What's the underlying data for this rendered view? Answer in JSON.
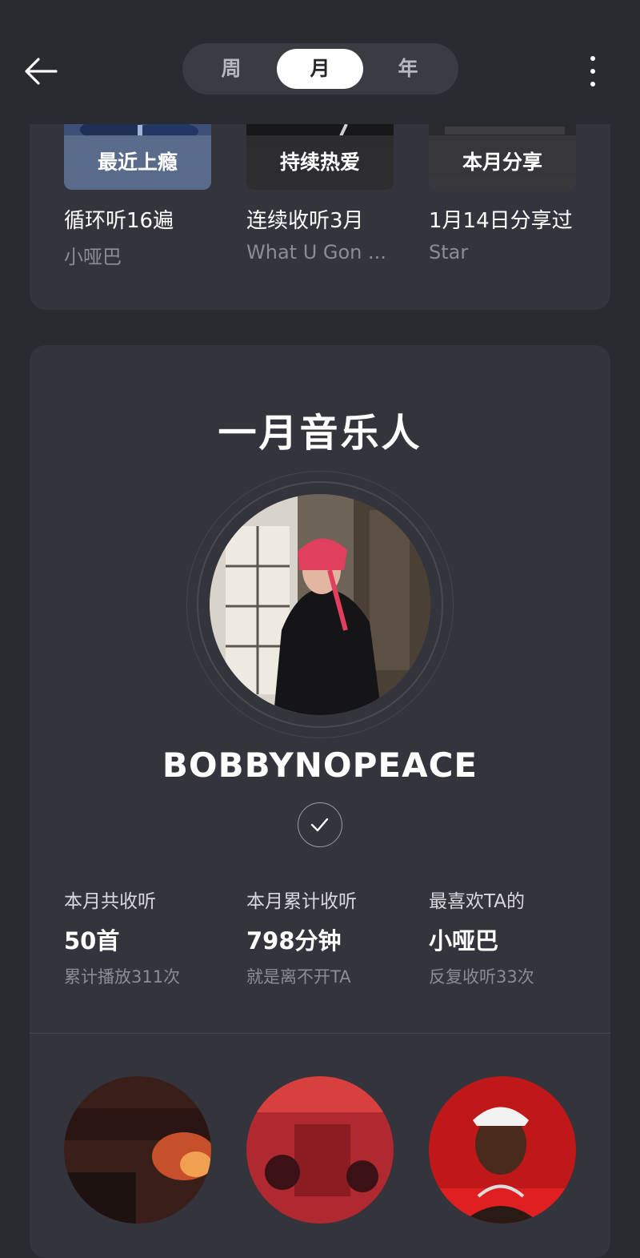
{
  "tabs": [
    {
      "label": "周",
      "active": false
    },
    {
      "label": "月",
      "active": true
    },
    {
      "label": "年",
      "active": false
    }
  ],
  "highlights": [
    {
      "tag": "最近上瘾",
      "title": "循环听16遍",
      "subtitle": "小哑巴"
    },
    {
      "tag": "持续热爱",
      "title": "连续收听3月",
      "subtitle": "What U Gon ..."
    },
    {
      "tag": "本月分享",
      "title": "1月14日分享过",
      "subtitle": "Star"
    }
  ],
  "artist_card": {
    "title": "一月音乐人",
    "artist_name": "BOBBYNOPEACE",
    "stats": [
      {
        "label": "本月共收听",
        "value": "50首",
        "note": "累计播放311次"
      },
      {
        "label": "本月累计收听",
        "value": "798分钟",
        "note": "就是离不开TA"
      },
      {
        "label": "最喜欢TA的",
        "value": "小哑巴",
        "note": "反复收听33次"
      }
    ]
  },
  "colors": {
    "background": "#2a2a31",
    "card": "#34343c",
    "text_secondary": "#8c8c93",
    "active_tab": "#ffffff"
  },
  "icons": {
    "back": "arrow-left-icon",
    "more": "more-vertical-icon",
    "verified": "checkmark-icon"
  }
}
